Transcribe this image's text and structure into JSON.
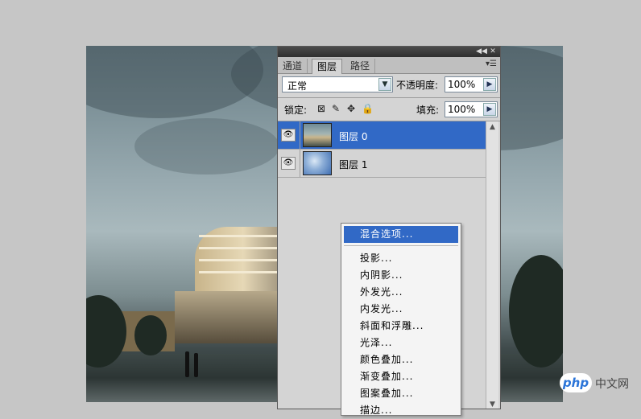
{
  "panel": {
    "tabs": [
      "通道",
      "图层",
      "路径"
    ],
    "active_tab_index": 1,
    "blend_mode": "正常",
    "opacity_label": "不透明度:",
    "opacity_value": "100%",
    "lock_label": "锁定:",
    "fill_label": "填充:",
    "fill_value": "100%",
    "lock_icons": [
      "lock-transparent-icon",
      "lock-brush-icon",
      "lock-move-icon",
      "lock-all-icon"
    ]
  },
  "layers": [
    {
      "name": "图层 0",
      "selected": true,
      "visible": true
    },
    {
      "name": "图层 1",
      "selected": false,
      "visible": true
    }
  ],
  "context_menu": {
    "items": [
      "混合选项...",
      "投影...",
      "内阴影...",
      "外发光...",
      "内发光...",
      "斜面和浮雕...",
      "光泽...",
      "颜色叠加...",
      "渐变叠加...",
      "图案叠加...",
      "描边..."
    ],
    "highlighted_index": 0
  },
  "watermark": {
    "logo": "php",
    "text": "中文网"
  },
  "colors": {
    "selection": "#3169c6",
    "panel_bg": "#d4d4d4",
    "background": "#c6c6c6"
  }
}
